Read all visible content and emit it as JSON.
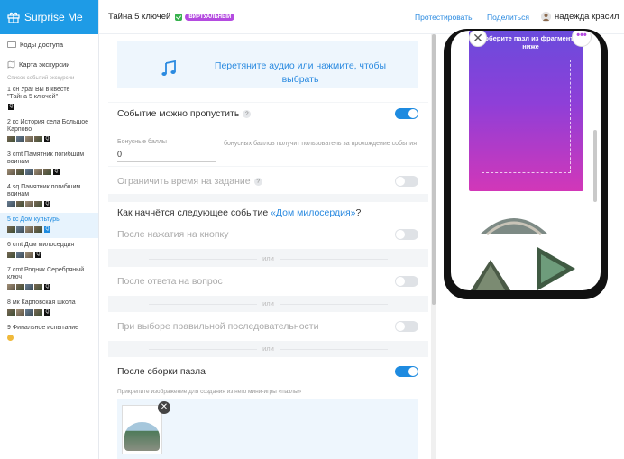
{
  "app": {
    "brand": "Surprise Me"
  },
  "topbar": {
    "title": "Тайна 5 ключей",
    "badge": "ВИРТУАЛЬНЫЙ",
    "test_link": "Протестировать",
    "share_link": "Поделиться",
    "user_name": "надежда красил"
  },
  "sidebar": {
    "links": [
      {
        "label": "Коды доступа"
      },
      {
        "label": "Карта экскурсии"
      }
    ],
    "section_label": "Список событий экскурсии",
    "events": [
      {
        "label": "1 сн Ура! Вы в квесте \"Тайна 5 ключей\""
      },
      {
        "label": "2 кс История села Большое Карпово"
      },
      {
        "label": "3 cmt Памятник погибшим воинам"
      },
      {
        "label": "4 sq Памятник погибшим воинам"
      },
      {
        "label": "5 кс Дом культуры"
      },
      {
        "label": "6 cmt Дом милосердия"
      },
      {
        "label": "7 cmt Родник Серебряный ключ"
      },
      {
        "label": "8 мк Карповская школа"
      },
      {
        "label": "9 Финальное испытание"
      }
    ]
  },
  "form": {
    "upload_text": "Перетяните аудио или нажмите, чтобы выбрать",
    "skippable_label": "Событие можно пропустить",
    "bonus_label": "Бонусные баллы",
    "bonus_value": "0",
    "bonus_desc": "бонусных баллов получит пользователь за прохождение события",
    "time_limit_label": "Ограничить время на задание",
    "next_question_prefix": "Как начнётся следующее событие",
    "next_question_link": "«Дом милосердия»",
    "next_question_suffix": "?",
    "option_button": "После нажатия на кнопку",
    "or_1": "или",
    "option_answer": "После ответа на вопрос",
    "or_2": "или",
    "option_sequence": "При выборе правильной последовательности",
    "or_3": "или",
    "option_puzzle": "После сборки пазла",
    "attach_note": "Прикрепите изображение для создания из него мини-игры «пазлы»",
    "help_glyph": "?"
  },
  "toggles": {
    "skippable": true,
    "time_limit": false,
    "option_button": false,
    "option_answer": false,
    "option_sequence": false,
    "option_puzzle": true
  },
  "preview": {
    "card_title": "Соберите пазл из фрагментов ниже",
    "close_glyph": "✕",
    "more_glyph": "•••"
  },
  "colors": {
    "brand_blue": "#1e9be6",
    "link_blue": "#2a8ae0",
    "badge_purple": "#b44be0",
    "toggle_on": "#1e8be0",
    "card_gradient_top": "#6a4bdc",
    "card_gradient_bottom": "#d237b8"
  }
}
